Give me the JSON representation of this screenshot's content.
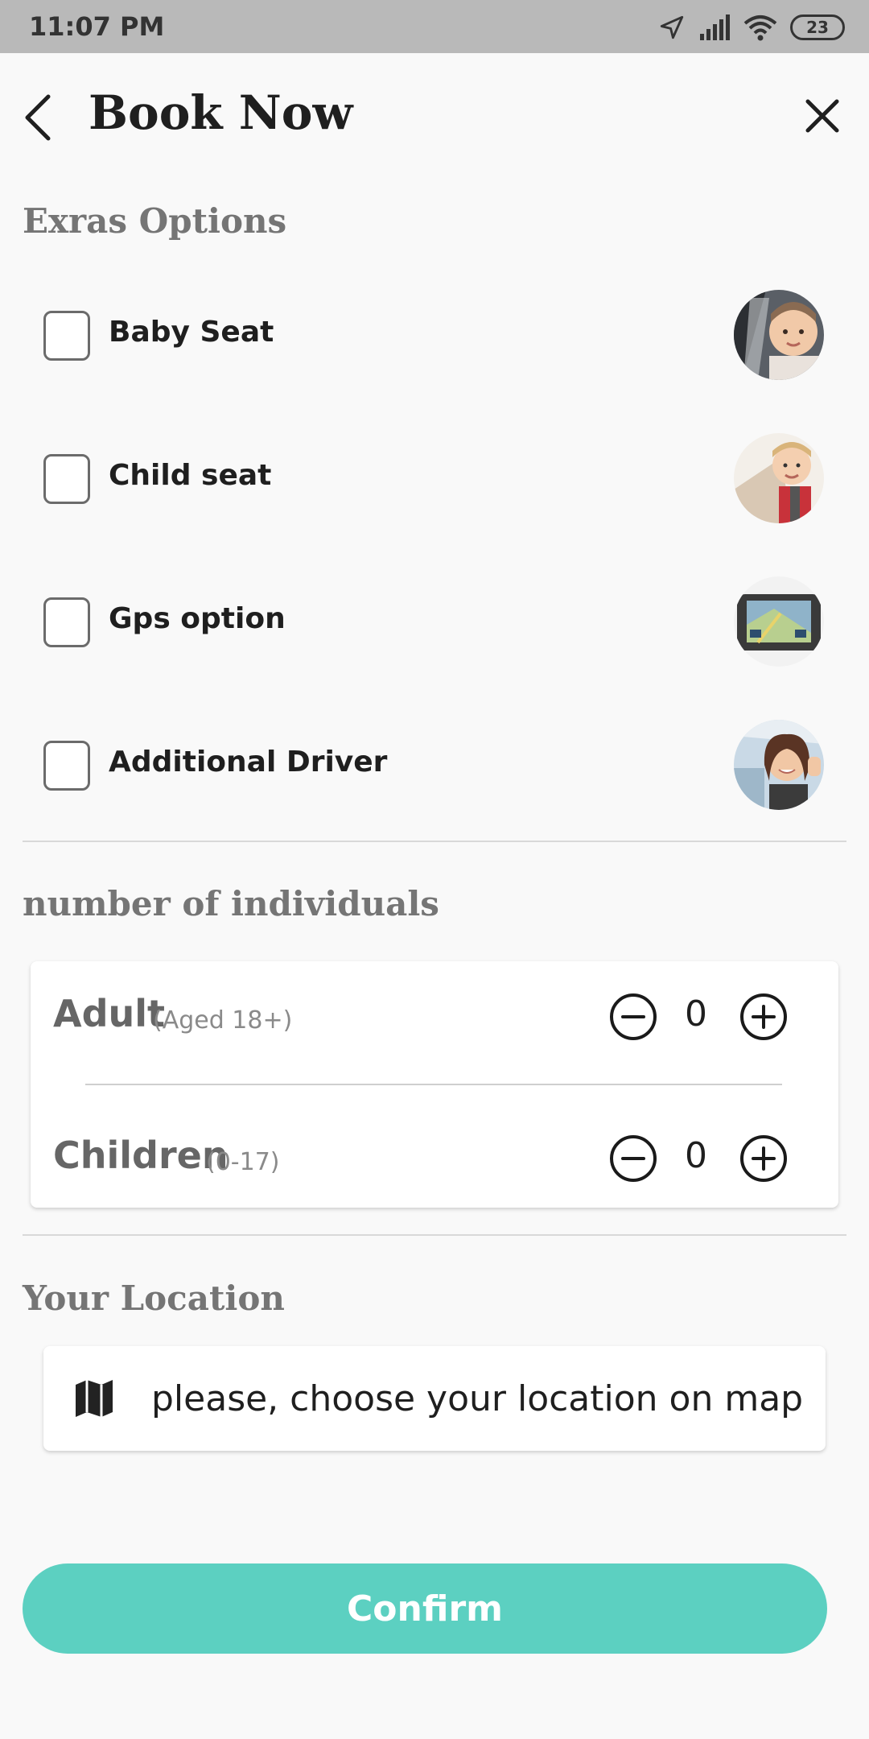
{
  "status_bar": {
    "time": "11:07 PM",
    "battery": "23",
    "icons": [
      "location-arrow-icon",
      "signal-icon",
      "wifi-icon",
      "battery-icon"
    ]
  },
  "header": {
    "title": "Book Now",
    "back_icon": "chevron-left-icon",
    "close_icon": "close-icon"
  },
  "extras": {
    "title": "Exras Options",
    "items": [
      {
        "label": "Baby Seat",
        "checked": false,
        "image": "baby-seat-photo"
      },
      {
        "label": "Child seat",
        "checked": false,
        "image": "child-seat-photo"
      },
      {
        "label": "Gps option",
        "checked": false,
        "image": "gps-device-photo"
      },
      {
        "label": "Additional Driver",
        "checked": false,
        "image": "driver-photo"
      }
    ]
  },
  "individuals": {
    "title": "number of individuals",
    "rows": [
      {
        "label": "Adult",
        "sublabel": "(Aged 18+)",
        "value": "0"
      },
      {
        "label": "Children",
        "sublabel": "(0-17)",
        "value": "0"
      }
    ]
  },
  "location": {
    "title": "Your Location",
    "placeholder": "please, choose your location on map",
    "icon": "map-icon"
  },
  "confirm_label": "Confirm",
  "colors": {
    "accent": "#5cd0c1",
    "status_bar": "#b9b9b9",
    "background": "#f9f9f9"
  }
}
